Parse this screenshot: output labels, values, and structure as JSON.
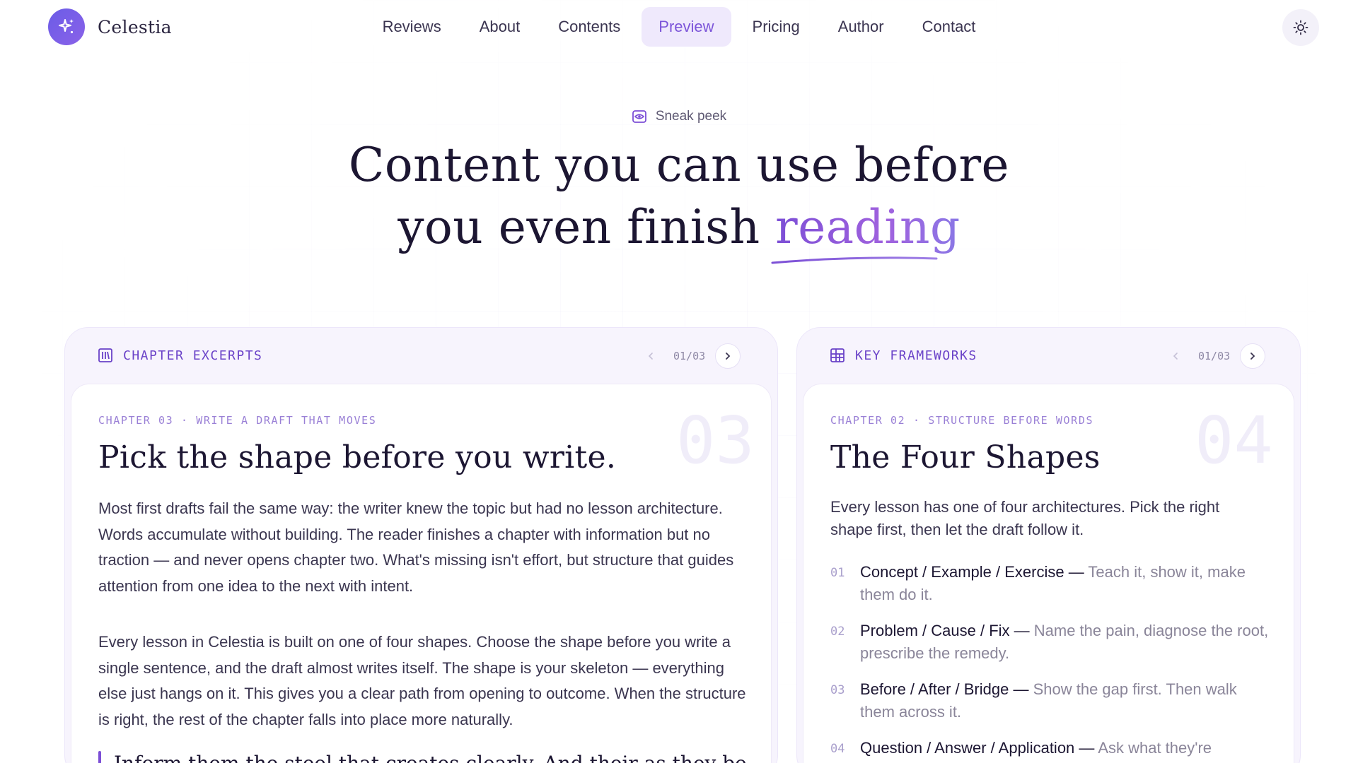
{
  "brand": {
    "name": "Celestia"
  },
  "nav": {
    "items": [
      {
        "label": "Reviews"
      },
      {
        "label": "About"
      },
      {
        "label": "Contents"
      },
      {
        "label": "Preview"
      },
      {
        "label": "Pricing"
      },
      {
        "label": "Author"
      },
      {
        "label": "Contact"
      }
    ],
    "active": "Preview"
  },
  "hero": {
    "eyebrow": "Sneak peek",
    "title_line1": "Content you can use before",
    "title_line2_plain": "you even finish",
    "title_line2_accent": "reading"
  },
  "excerpts": {
    "label": "CHAPTER EXCERPTS",
    "pager": "01/03",
    "kicker": "CHAPTER 03 · WRITE A DRAFT THAT MOVES",
    "number": "03",
    "title": "Pick the shape before you write.",
    "para1": "Most first drafts fail the same way: the writer knew the topic but had no lesson architecture. Words accumulate without building. The reader finishes a chapter with information but no traction — and never opens chapter two. What's missing isn't effort, but structure that guides attention from one idea to the next with intent.",
    "para2": "Every lesson in Celestia is built on one of four shapes. Choose the shape before you write a single sentence, and the draft almost writes itself. The shape is your skeleton — everything else just hangs on it. This gives you a clear path from opening to outcome. When the structure is right, the rest of the chapter falls into place more naturally.",
    "quote": "Inform them the steel that creates clearly. And their as they be"
  },
  "frameworks": {
    "label": "KEY FRAMEWORKS",
    "pager": "01/03",
    "kicker": "CHAPTER 02 · STRUCTURE BEFORE WORDS",
    "number": "04",
    "title": "The Four Shapes",
    "intro": "Every lesson has one of four architectures. Pick the right shape first, then let the draft follow it.",
    "items": [
      {
        "num": "01",
        "name": "Concept / Example / Exercise",
        "desc": "Teach it, show it, make them do it."
      },
      {
        "num": "02",
        "name": "Problem / Cause / Fix",
        "desc": "Name the pain, diagnose the root, prescribe the remedy."
      },
      {
        "num": "03",
        "name": "Before / After / Bridge",
        "desc": "Show the gap first. Then walk them across it."
      },
      {
        "num": "04",
        "name": "Question / Answer / Application",
        "desc": "Ask what they're"
      }
    ]
  },
  "colors": {
    "accent": "#7c4fd6",
    "accent_light": "#efe9fc",
    "panel_bg": "#f7f4fd"
  }
}
